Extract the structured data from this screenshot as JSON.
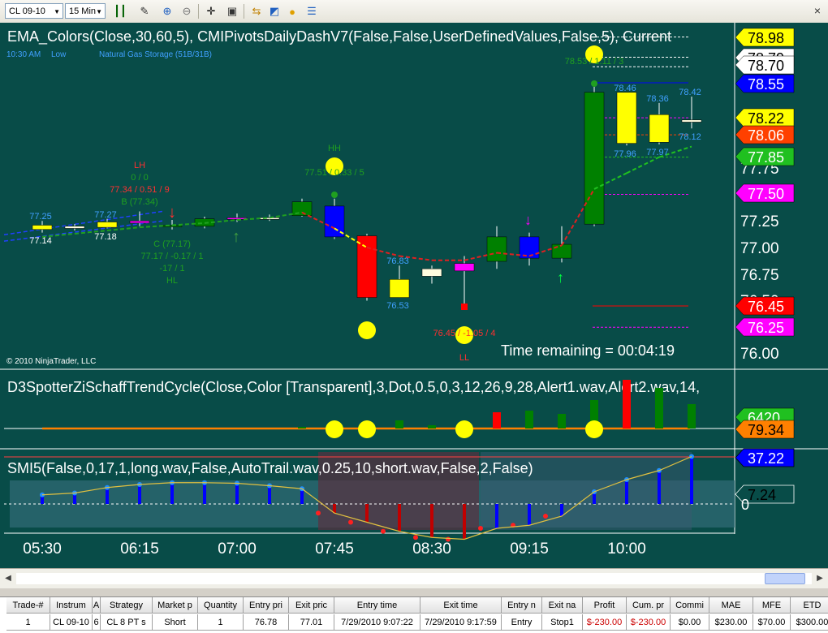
{
  "toolbar": {
    "instrument": "CL 09-10",
    "interval": "15 Min",
    "icons": [
      "bar-type-icon",
      "drawing-tool-icon",
      "zoom-in-icon",
      "zoom-out-icon",
      "crosshair-icon",
      "data-box-icon",
      "instrument-list-icon",
      "strategy-icon",
      "indicator-icon",
      "properties-icon"
    ],
    "close": "×"
  },
  "panels": {
    "price": {
      "title": "EMA_Colors(Close,30,60,5),  CMIPivotsDailyDashV7(False,False,UserDefinedValues,False,5),  Current",
      "info_time": "10:30 AM",
      "info_level": "Low",
      "info_event": "Natural Gas Storage (51B/31B)",
      "copyright": "© 2010 NinjaTrader, LLC",
      "time_remaining": "Time remaining = 00:04:19",
      "axis_ticks": [
        "77.75",
        "77.50",
        "77.25",
        "77.00",
        "76.75",
        "76.50",
        "76.00"
      ],
      "price_labels": [
        {
          "text": "78.98",
          "bg": "#ffff00",
          "fg": "#000000"
        },
        {
          "text": "78.79",
          "bg": "#ffffff",
          "fg": "#000000"
        },
        {
          "text": "78.70",
          "bg": "#ffffff",
          "fg": "#000000"
        },
        {
          "text": "78.55",
          "bg": "#0000ff",
          "fg": "#ffffff"
        },
        {
          "text": "78.22",
          "bg": "#ffff00",
          "fg": "#000000"
        },
        {
          "text": "78.06",
          "bg": "#ff4000",
          "fg": "#ffffff"
        },
        {
          "text": "77.85",
          "bg": "#20c020",
          "fg": "#ffffff"
        },
        {
          "text": "77.50",
          "bg": "#ff00ff",
          "fg": "#ffffff"
        },
        {
          "text": "76.45",
          "bg": "#ff0000",
          "fg": "#ffffff"
        },
        {
          "text": "76.25",
          "bg": "#ff00ff",
          "fg": "#ffffff"
        }
      ],
      "annotations": {
        "lh": "LH",
        "lh_ratio": "0 / 0",
        "lh_vals": "77.34 / 0.51 / 9",
        "lh_b": "B (77.34)",
        "hh": "HH",
        "hh_vals": "77.51 / 0.33 / 5",
        "c_label": "C (77.17)",
        "c_vals": "77.17 / -0.17 / 1",
        "c_vals2": "-17 / 1",
        "hl": "HL",
        "ll_vals": "76.45 / -1.05 / 4",
        "ll": "LL",
        "top_vals": "78.53 / 1.11 / 3",
        "p1": "77.25",
        "p2": "77.14",
        "p3": "77.27",
        "p4": "77.18",
        "p5": "76.83",
        "p6": "76.53",
        "p7": "78.46",
        "p8": "77.96",
        "p9": "78.36",
        "p10": "77.97",
        "p11": "78.42",
        "p12": "78.12"
      }
    },
    "schaff": {
      "title": "D3SpotterZiSchaffTrendCycle(Close,Color  [Transparent],3,Dot,0.5,0,3,12,26,9,28,Alert1.wav,Alert2.wav,14,",
      "labels": [
        {
          "text": "6420",
          "bg": "#20c020",
          "fg": "#ffffff"
        },
        {
          "text": "79.34",
          "bg": "#ff8000",
          "fg": "#000000"
        }
      ]
    },
    "smi": {
      "title": "SMI5(False,0,17,1,long.wav,False,AutoTrail.wav,0.25,10,short.wav,False,2,False)",
      "labels": [
        {
          "text": "37.22",
          "bg": "#0000ff",
          "fg": "#ffffff"
        },
        {
          "text": "7.24",
          "bg": "#084c48",
          "fg": "#000000"
        }
      ],
      "zero": "0"
    }
  },
  "time_axis": [
    "05:30",
    "06:15",
    "07:00",
    "07:45",
    "08:30",
    "09:15",
    "10:00"
  ],
  "colors": {
    "background": "#084c48",
    "up": "#008000",
    "down": "#ff0000",
    "neutral": "#ffff00",
    "blue": "#0000ff",
    "magenta": "#ff00ff"
  },
  "chart_data": {
    "type": "candlestick",
    "x": [
      "05:30",
      "05:45",
      "06:00",
      "06:15",
      "06:30",
      "06:45",
      "07:00",
      "07:15",
      "07:30",
      "07:45",
      "08:00",
      "08:15",
      "08:30",
      "08:45",
      "09:00",
      "09:15",
      "09:30",
      "09:45",
      "10:00",
      "10:15",
      "10:30"
    ],
    "candles": [
      {
        "o": 77.21,
        "h": 77.25,
        "l": 77.14,
        "c": 77.17,
        "color": "yellow"
      },
      {
        "o": 77.18,
        "h": 77.22,
        "l": 77.16,
        "c": 77.2,
        "color": "white"
      },
      {
        "o": 77.19,
        "h": 77.27,
        "l": 77.18,
        "c": 77.24,
        "color": "yellow"
      },
      {
        "o": 77.23,
        "h": 77.34,
        "l": 77.2,
        "c": 77.25,
        "color": "magenta"
      },
      {
        "o": 77.2,
        "h": 77.26,
        "l": 77.17,
        "c": 77.21,
        "color": "green"
      },
      {
        "o": 77.2,
        "h": 77.29,
        "l": 77.18,
        "c": 77.27,
        "color": "green"
      },
      {
        "o": 77.28,
        "h": 77.32,
        "l": 77.24,
        "c": 77.27,
        "color": "magenta"
      },
      {
        "o": 77.27,
        "h": 77.31,
        "l": 77.25,
        "c": 77.28,
        "color": "white"
      },
      {
        "o": 77.3,
        "h": 77.46,
        "l": 77.29,
        "c": 77.43,
        "color": "green"
      },
      {
        "o": 77.39,
        "h": 77.46,
        "l": 77.08,
        "c": 77.1,
        "color": "blue"
      },
      {
        "o": 77.11,
        "h": 77.13,
        "l": 76.5,
        "c": 76.53,
        "color": "red"
      },
      {
        "o": 76.53,
        "h": 76.83,
        "l": 76.53,
        "c": 76.7,
        "color": "yellow"
      },
      {
        "o": 76.73,
        "h": 76.83,
        "l": 76.66,
        "c": 76.8,
        "color": "white"
      },
      {
        "o": 76.85,
        "h": 76.92,
        "l": 76.45,
        "c": 76.78,
        "color": "magenta"
      },
      {
        "o": 76.87,
        "h": 77.2,
        "l": 76.8,
        "c": 77.1,
        "color": "green"
      },
      {
        "o": 77.1,
        "h": 77.14,
        "l": 76.83,
        "c": 76.9,
        "color": "blue"
      },
      {
        "o": 76.9,
        "h": 77.2,
        "l": 76.86,
        "c": 77.03,
        "color": "green"
      },
      {
        "o": 77.22,
        "h": 78.53,
        "l": 77.2,
        "c": 78.46,
        "color": "green"
      },
      {
        "o": 78.46,
        "h": 78.46,
        "l": 77.96,
        "c": 77.98,
        "color": "yellow"
      },
      {
        "o": 78.25,
        "h": 78.36,
        "l": 77.97,
        "c": 77.99,
        "color": "yellow"
      },
      {
        "o": 78.2,
        "h": 78.42,
        "l": 78.12,
        "c": 78.18,
        "color": "white"
      }
    ],
    "ema_fast": [
      77.1,
      77.13,
      77.16,
      77.19,
      77.21,
      77.23,
      77.26,
      77.28,
      77.33,
      77.18,
      77.0,
      76.92,
      76.88,
      76.88,
      76.95,
      76.92,
      77.02,
      77.55,
      77.7,
      77.85,
      77.95
    ],
    "schaff_values": [
      0,
      0,
      0,
      0,
      0,
      0,
      0,
      0,
      2,
      5,
      3,
      10,
      4,
      2,
      20,
      22,
      18,
      35,
      60,
      50,
      30
    ],
    "smi_values": [
      15,
      18,
      27,
      32,
      35,
      35,
      34,
      30,
      25,
      -15,
      -30,
      -45,
      -55,
      -58,
      -40,
      -35,
      -20,
      20,
      40,
      55,
      78
    ],
    "hlines": [
      78.98,
      78.79,
      78.7,
      78.55,
      78.22,
      78.06,
      77.85,
      77.5,
      76.45,
      76.25
    ]
  },
  "trades_table": {
    "columns": [
      "Trade-#",
      "Instrum",
      "A",
      "Strategy",
      "Market p",
      "Quantity",
      "Entry pri",
      "Exit pric",
      "Entry time",
      "Exit time",
      "Entry n",
      "Exit na",
      "Profit",
      "Cum. pr",
      "Commi",
      "MAE",
      "MFE",
      "ETD"
    ],
    "rows": [
      [
        "1",
        "CL 09-10",
        "6",
        "CL 8 PT s",
        "Short",
        "1",
        "76.78",
        "77.01",
        "7/29/2010 9:07:22",
        "7/29/2010 9:17:59",
        "Entry",
        "Stop1",
        "$-230.00",
        "$-230.00",
        "$0.00",
        "$230.00",
        "$70.00",
        "$300.00"
      ]
    ]
  }
}
